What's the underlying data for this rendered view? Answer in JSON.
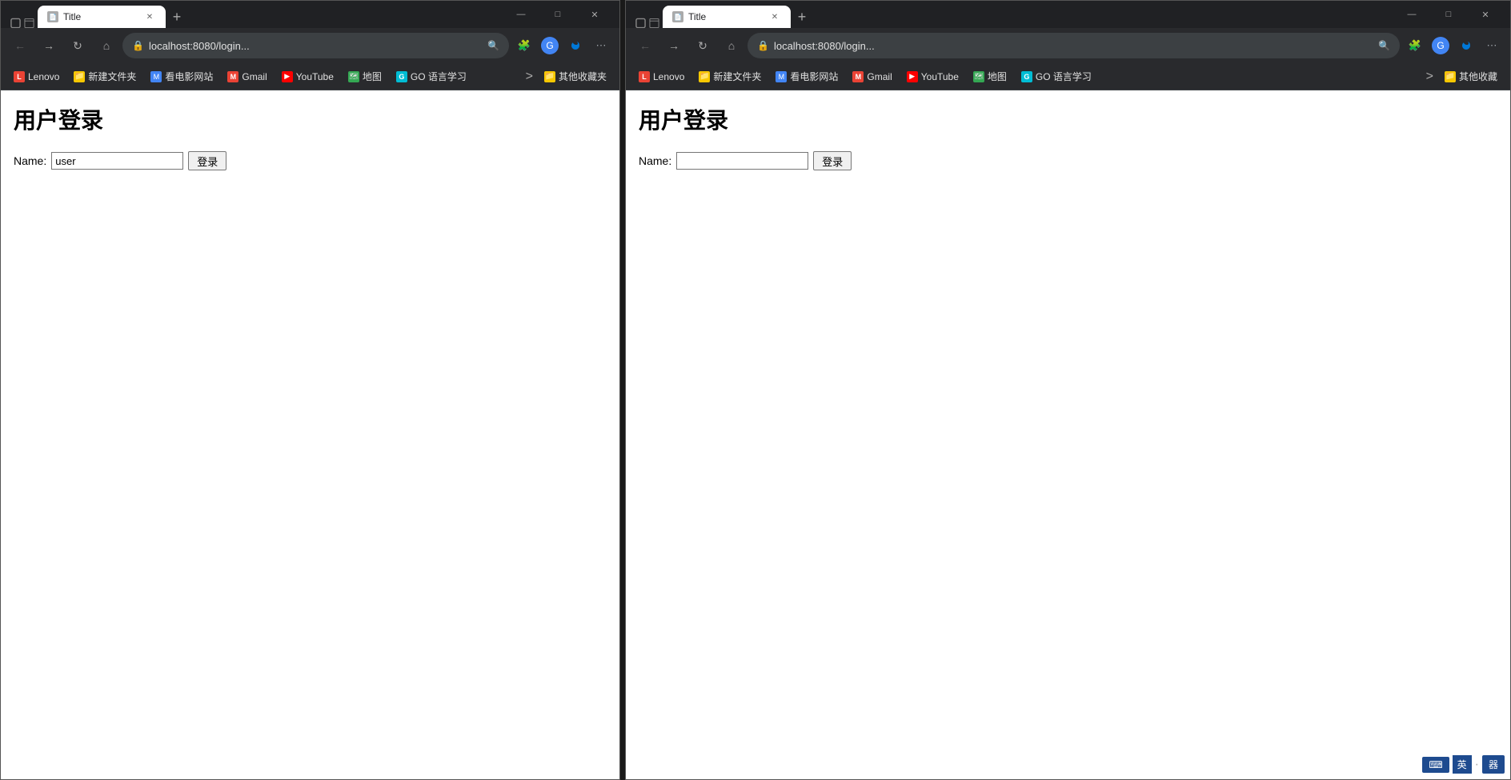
{
  "left_window": {
    "tab": {
      "title": "Title",
      "favicon": "📄"
    },
    "address": "localhost:8080/login...",
    "bookmarks": [
      {
        "label": "Lenovo",
        "icon": "L",
        "color": "bm-red"
      },
      {
        "label": "新建文件夹",
        "icon": "📁",
        "color": "bm-yellow"
      },
      {
        "label": "看电影网站",
        "icon": "🎬",
        "color": "bm-blue"
      },
      {
        "label": "Gmail",
        "icon": "M",
        "color": "bm-blue"
      },
      {
        "label": "YouTube",
        "icon": "▶",
        "color": "bm-yt"
      },
      {
        "label": "地图",
        "icon": "🗺",
        "color": "bm-maps"
      },
      {
        "label": "GO 语言学习",
        "icon": "G",
        "color": "bm-lightblue"
      },
      {
        "label": "其他收藏夹",
        "icon": "📁",
        "color": "bm-yellow"
      }
    ],
    "page": {
      "title": "用户登录",
      "form_label": "Name:",
      "input_value": "user",
      "button_label": "登录"
    }
  },
  "right_window": {
    "tab": {
      "title": "Title",
      "favicon": "📄"
    },
    "address": "localhost:8080/login...",
    "bookmarks": [
      {
        "label": "Lenovo",
        "icon": "L",
        "color": "bm-red"
      },
      {
        "label": "新建文件夹",
        "icon": "📁",
        "color": "bm-yellow"
      },
      {
        "label": "看电影网站",
        "icon": "🎬",
        "color": "bm-blue"
      },
      {
        "label": "Gmail",
        "icon": "M",
        "color": "bm-blue"
      },
      {
        "label": "YouTube",
        "icon": "▶",
        "color": "bm-yt"
      },
      {
        "label": "地图",
        "icon": "🗺",
        "color": "bm-maps"
      },
      {
        "label": "GO 语言学习",
        "icon": "G",
        "color": "bm-lightblue"
      },
      {
        "label": "其他收藏",
        "icon": "📁",
        "color": "bm-yellow"
      }
    ],
    "page": {
      "title": "用户登录",
      "form_label": "Name:",
      "input_value": "",
      "button_label": "登录"
    }
  },
  "taskbar": {
    "lang_label": "英",
    "dot": "·",
    "icon_label": "器"
  },
  "nav": {
    "back": "←",
    "forward": "→",
    "refresh": "↻",
    "home": "⌂",
    "more": "⋯"
  },
  "win_controls": {
    "minimize": "—",
    "maximize": "□",
    "close": "✕"
  }
}
